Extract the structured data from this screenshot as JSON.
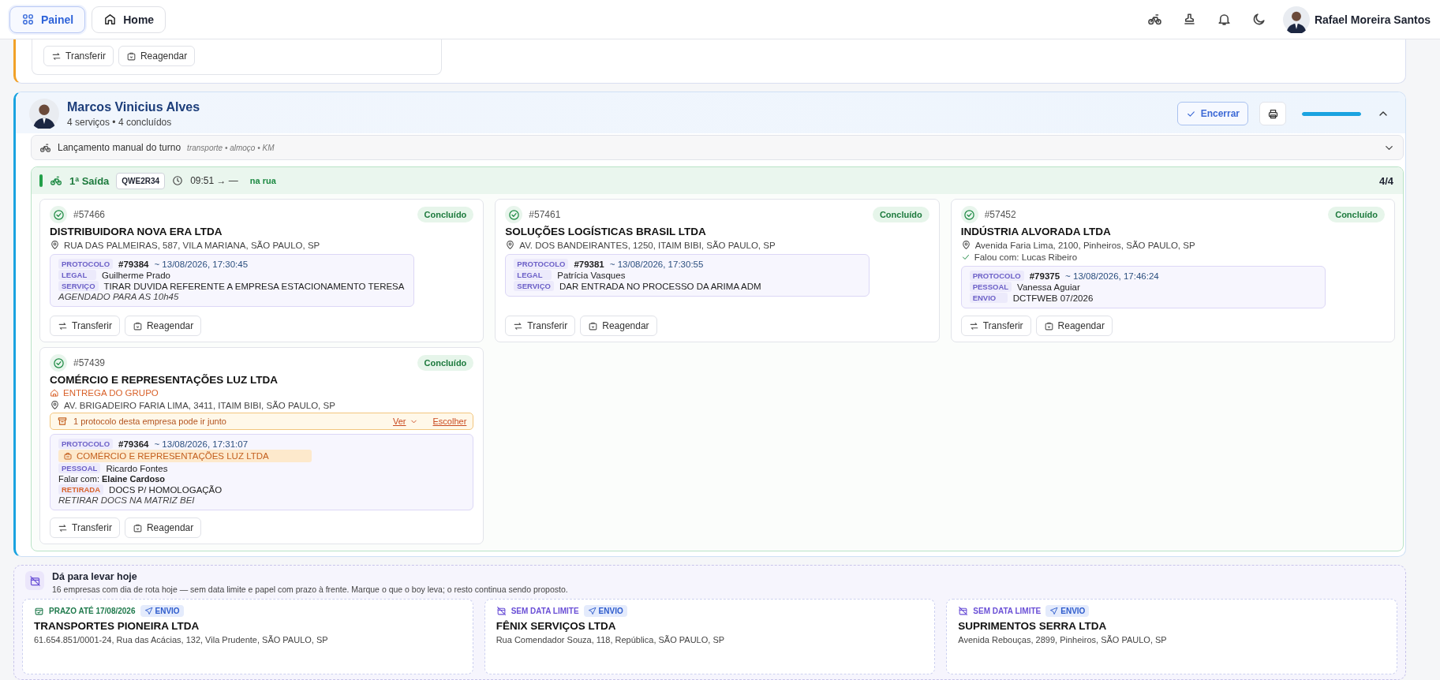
{
  "nav": {
    "tabs": [
      {
        "kind": "panel",
        "label": "Painel",
        "selected": true
      },
      {
        "kind": "home",
        "label": "Home",
        "selected": false
      }
    ],
    "user": {
      "name": "Rafael Moreira Santos"
    }
  },
  "previous_group": {
    "actions": [
      {
        "kind": "transfer",
        "label": "Transferir"
      },
      {
        "kind": "reschedule",
        "label": "Reagendar"
      }
    ]
  },
  "courier": {
    "name": "Marcos Vinicius Alves",
    "summary": "4 serviços • 4 concluídos",
    "close_button": "Encerrar",
    "progress": {
      "level": 1
    },
    "expanded": true,
    "manual_entry": {
      "label": "Lançamento manual do turno",
      "hint": "transporte • almoço • KM",
      "expanded": false
    },
    "trip": {
      "title": "1ª Saída",
      "plate": "QWE2R34",
      "time": "09:51 → —",
      "status": "na rua",
      "count": "4/4",
      "services": [
        {
          "id": "#57466",
          "status": "Concluído",
          "company": "DISTRIBUIDORA NOVA ERA LTDA",
          "address": "RUA DAS PALMEIRAS, 587, VILA MARIANA, SÃO PAULO, SP",
          "protocol": {
            "label": "PROTOCOLO",
            "number": "#79384",
            "date": "~ 13/08/2026, 17:30:45",
            "rows": [
              {
                "kind": "tag",
                "tag": "LEGAL",
                "color": "#6b5fc7",
                "text": "Guilherme Prado"
              },
              {
                "kind": "tag",
                "tag": "SERVIÇO",
                "color": "#6b5fc7",
                "text": "TIRAR DUVIDA REFERENTE A EMPRESA ESTACIONAMENTO TERESA"
              },
              {
                "kind": "note",
                "text": "AGENDADO PARA AS 10h45"
              }
            ]
          },
          "actions": [
            {
              "kind": "transfer",
              "label": "Transferir"
            },
            {
              "kind": "reschedule",
              "label": "Reagendar"
            }
          ]
        },
        {
          "id": "#57461",
          "status": "Concluído",
          "company": "SOLUÇÕES LOGÍSTICAS BRASIL LTDA",
          "address": "AV. DOS BANDEIRANTES, 1250, ITAIM BIBI, SÃO PAULO, SP",
          "protocol": {
            "label": "PROTOCOLO",
            "number": "#79381",
            "date": "~ 13/08/2026, 17:30:55",
            "rows": [
              {
                "kind": "tag",
                "tag": "LEGAL",
                "color": "#6b5fc7",
                "text": "Patrícia Vasques"
              },
              {
                "kind": "tag",
                "tag": "SERVIÇO",
                "color": "#6b5fc7",
                "text": "DAR ENTRADA NO PROCESSO DA ARIMA ADM"
              }
            ]
          },
          "actions": [
            {
              "kind": "transfer",
              "label": "Transferir"
            },
            {
              "kind": "reschedule",
              "label": "Reagendar"
            }
          ]
        },
        {
          "id": "#57452",
          "status": "Concluído",
          "company": "INDÚSTRIA ALVORADA LTDA",
          "address": "Avenida Faria Lima, 2100, Pinheiros, SÃO PAULO, SP",
          "contact": "Falou com: Lucas Ribeiro",
          "protocol": {
            "label": "PROTOCOLO",
            "number": "#79375",
            "date": "~ 13/08/2026, 17:46:24",
            "rows": [
              {
                "kind": "tag",
                "tag": "PESSOAL",
                "color": "#6b5fc7",
                "text": "Vanessa Aguiar"
              },
              {
                "kind": "tag",
                "tag": "ENVIO",
                "color": "#6b5fc7",
                "text": "DCTFWEB 07/2026"
              }
            ]
          },
          "actions": [
            {
              "kind": "transfer",
              "label": "Transferir"
            },
            {
              "kind": "reschedule",
              "label": "Reagendar"
            }
          ]
        },
        {
          "id": "#57439",
          "status": "Concluído",
          "company": "COMÉRCIO E REPRESENTAÇÕES LUZ LTDA",
          "group_label": "ENTREGA DO GRUPO",
          "address": "AV. BRIGADEIRO FARIA LIMA, 3411, ITAIM BIBI, SÃO PAULO, SP",
          "notice": {
            "text": "1 protocolo desta empresa pode ir junto",
            "view": "Ver",
            "choose": "Escolher"
          },
          "protocol": {
            "label": "PROTOCOLO",
            "number": "#79364",
            "date": "~ 13/08/2026, 17:31:07",
            "rows": [
              {
                "kind": "company",
                "text": "COMÉRCIO E REPRESENTAÇÕES LUZ LTDA"
              },
              {
                "kind": "tag",
                "tag": "PESSOAL",
                "color": "#6b5fc7",
                "text": "Ricardo Fontes"
              },
              {
                "kind": "contact",
                "text": "Falar com: **Elaine Cardoso**"
              },
              {
                "kind": "tag",
                "tag": "RETIRADA",
                "color": "#d9622b",
                "text": "DOCS P/ HOMOLOGAÇÃO"
              },
              {
                "kind": "note",
                "text": "RETIRAR DOCS NA MATRIZ BEI"
              }
            ]
          },
          "actions": [
            {
              "kind": "transfer",
              "label": "Transferir"
            },
            {
              "kind": "reschedule",
              "label": "Reagendar"
            }
          ]
        }
      ]
    }
  },
  "suggestions": {
    "title": "Dá para levar hoje",
    "description": "16 empresas com dia de rota hoje — sem data limite e papel com prazo à frente. Marque o que o boy leva; o resto continua sendo proposto.",
    "items": [
      {
        "deadline": {
          "kind": "date",
          "text": "PRAZO ATÉ 17/08/2026"
        },
        "tag": "ENVIO",
        "company": "TRANSPORTES PIONEIRA LTDA",
        "address": "61.654.851/0001-24, Rua das Acácias, 132, Vila Prudente, SÃO PAULO, SP"
      },
      {
        "deadline": {
          "kind": "none",
          "text": "SEM DATA LIMITE"
        },
        "tag": "ENVIO",
        "company": "FÊNIX SERVIÇOS LTDA",
        "address": "Rua Comendador Souza, 118, República, SÃO PAULO, SP"
      },
      {
        "deadline": {
          "kind": "none",
          "text": "SEM DATA LIMITE"
        },
        "tag": "ENVIO",
        "company": "SUPRIMENTOS SERRA LTDA",
        "address": "Avenida Rebouças, 2899, Pinheiros, SÃO PAULO, SP"
      }
    ]
  }
}
